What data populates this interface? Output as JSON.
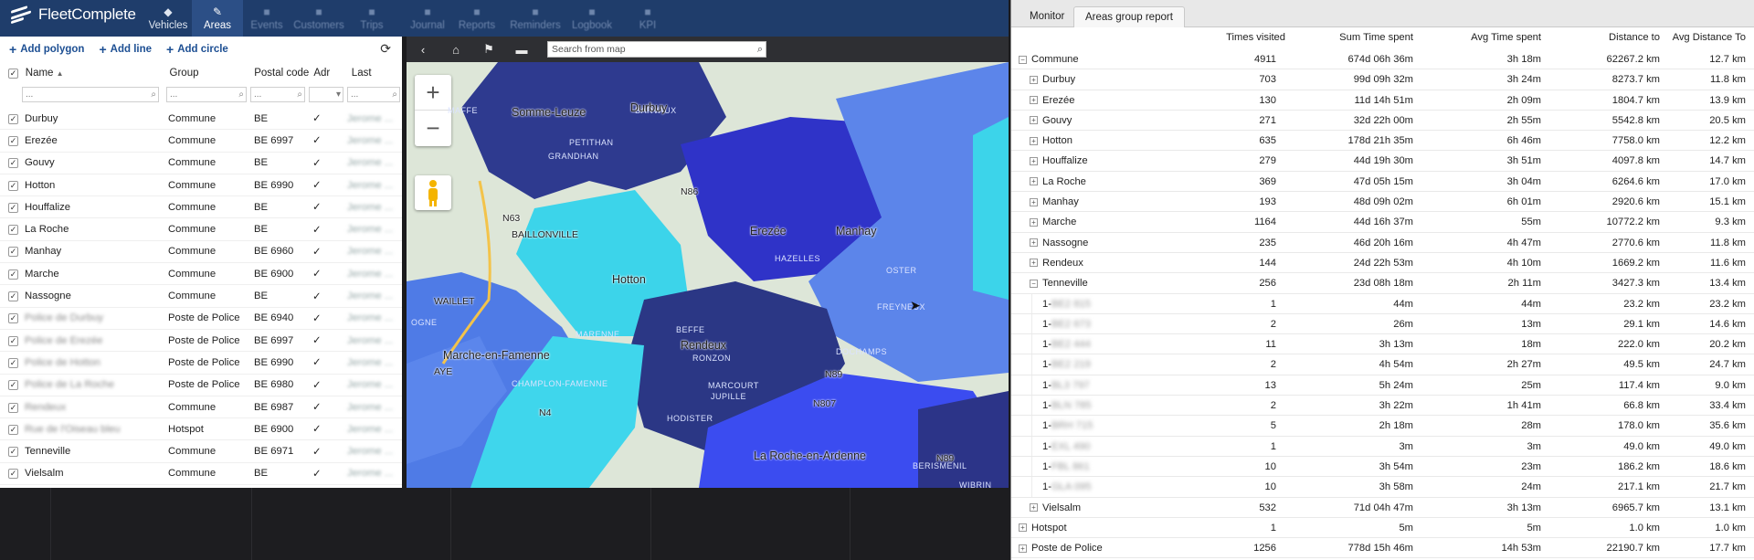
{
  "app": {
    "logo_text": "FleetComplete"
  },
  "nav": [
    {
      "label": "Vehicles",
      "icon": "car-icon"
    },
    {
      "label": "Areas",
      "icon": "pin-icon",
      "active": true
    },
    {
      "label": "Events",
      "icon": "alert-icon"
    },
    {
      "label": "Customers",
      "icon": "people-icon"
    },
    {
      "label": "Trips",
      "icon": "route-icon"
    },
    {
      "label": "Journal",
      "icon": "book-icon"
    },
    {
      "label": "Reports",
      "icon": "chart-icon"
    },
    {
      "label": "Reminders",
      "icon": "bell-icon"
    },
    {
      "label": "Logbook",
      "icon": "logbook-icon"
    },
    {
      "label": "KPI",
      "icon": "kpi-icon"
    }
  ],
  "toolbar": {
    "add_polygon": "Add polygon",
    "add_line": "Add line",
    "add_circle": "Add circle"
  },
  "columns": {
    "name": "Name",
    "group": "Group",
    "postal": "Postal code",
    "adr": "Adr",
    "last_update": "Last update"
  },
  "filter_placeholder": "...",
  "areas": [
    {
      "name": "Durbuy",
      "group": "Commune",
      "postal": "BE",
      "adr": "✓",
      "blur_name": false
    },
    {
      "name": "Erezée",
      "group": "Commune",
      "postal": "BE 6997",
      "adr": "✓",
      "blur_name": false
    },
    {
      "name": "Gouvy",
      "group": "Commune",
      "postal": "BE",
      "adr": "✓",
      "blur_name": false
    },
    {
      "name": "Hotton",
      "group": "Commune",
      "postal": "BE 6990",
      "adr": "✓",
      "blur_name": false
    },
    {
      "name": "Houffalize",
      "group": "Commune",
      "postal": "BE",
      "adr": "✓",
      "blur_name": false
    },
    {
      "name": "La Roche",
      "group": "Commune",
      "postal": "BE",
      "adr": "✓",
      "blur_name": false
    },
    {
      "name": "Manhay",
      "group": "Commune",
      "postal": "BE 6960",
      "adr": "✓",
      "blur_name": false
    },
    {
      "name": "Marche",
      "group": "Commune",
      "postal": "BE 6900",
      "adr": "✓",
      "blur_name": false
    },
    {
      "name": "Nassogne",
      "group": "Commune",
      "postal": "BE",
      "adr": "✓",
      "blur_name": false
    },
    {
      "name": "Police de Durbuy",
      "group": "Poste de Police",
      "postal": "BE 6940",
      "adr": "✓",
      "blur_name": true
    },
    {
      "name": "Police de Erezée",
      "group": "Poste de Police",
      "postal": "BE 6997",
      "adr": "✓",
      "blur_name": true
    },
    {
      "name": "Police de Hotton",
      "group": "Poste de Police",
      "postal": "BE 6990",
      "adr": "✓",
      "blur_name": true
    },
    {
      "name": "Police de La Roche",
      "group": "Poste de Police",
      "postal": "BE 6980",
      "adr": "✓",
      "blur_name": true
    },
    {
      "name": "Rendeux",
      "group": "Commune",
      "postal": "BE 6987",
      "adr": "✓",
      "blur_name": true
    },
    {
      "name": "Rue de l'Oiseau bleu",
      "group": "Hotspot",
      "postal": "BE 6900",
      "adr": "✓",
      "blur_name": true
    },
    {
      "name": "Tenneville",
      "group": "Commune",
      "postal": "BE 6971",
      "adr": "✓",
      "blur_name": false
    },
    {
      "name": "Vielsalm",
      "group": "Commune",
      "postal": "BE",
      "adr": "✓",
      "blur_name": false
    }
  ],
  "map": {
    "search_placeholder": "Search from map",
    "labels": [
      "Somme-Leuze",
      "BAILLONVILLE",
      "WAILLET",
      "Hotton",
      "Erezée",
      "HAZELLES",
      "Manhay",
      "Marche-en-Famenne",
      "CHAMPLON-FAMENNE",
      "Rendeux",
      "RONZON",
      "MARCOURT",
      "JUPILLE",
      "HODISTER",
      "DOCHAMPS",
      "FREYNEUX",
      "OSTER",
      "La Roche-en-Ardenne",
      "BERISMENIL",
      "WIBRIN",
      "NADRIN",
      "BEFFE",
      "MARENNE",
      "PETITHAN",
      "GRANDHAN",
      "BARVAUX",
      "Durbuy",
      "MAFFE",
      "AYE",
      "OGNE",
      "N63",
      "N86",
      "N89",
      "N4",
      "N807",
      "N89",
      "N30"
    ]
  },
  "report": {
    "tabs": [
      "Monitor",
      "Areas group report"
    ],
    "headers": [
      "Times visited",
      "Sum Time spent",
      "Avg Time spent",
      "Distance to",
      "Avg Distance To"
    ],
    "rows": [
      {
        "level": 0,
        "toggle": "−",
        "name": "Commune",
        "times": "4911",
        "sum": "674d 06h 36m",
        "avg": "3h 18m",
        "dist": "62267.2 km",
        "avgdist": "12.7 km"
      },
      {
        "level": 1,
        "toggle": "+",
        "name": "Durbuy",
        "times": "703",
        "sum": "99d 09h 32m",
        "avg": "3h 24m",
        "dist": "8273.7 km",
        "avgdist": "11.8 km"
      },
      {
        "level": 1,
        "toggle": "+",
        "name": "Erezée",
        "times": "130",
        "sum": "11d 14h 51m",
        "avg": "2h 09m",
        "dist": "1804.7 km",
        "avgdist": "13.9 km"
      },
      {
        "level": 1,
        "toggle": "+",
        "name": "Gouvy",
        "times": "271",
        "sum": "32d 22h 00m",
        "avg": "2h 55m",
        "dist": "5542.8 km",
        "avgdist": "20.5 km"
      },
      {
        "level": 1,
        "toggle": "+",
        "name": "Hotton",
        "times": "635",
        "sum": "178d 21h 35m",
        "avg": "6h 46m",
        "dist": "7758.0 km",
        "avgdist": "12.2 km"
      },
      {
        "level": 1,
        "toggle": "+",
        "name": "Houffalize",
        "times": "279",
        "sum": "44d 19h 30m",
        "avg": "3h 51m",
        "dist": "4097.8 km",
        "avgdist": "14.7 km"
      },
      {
        "level": 1,
        "toggle": "+",
        "name": "La Roche",
        "times": "369",
        "sum": "47d 05h 15m",
        "avg": "3h 04m",
        "dist": "6264.6 km",
        "avgdist": "17.0 km"
      },
      {
        "level": 1,
        "toggle": "+",
        "name": "Manhay",
        "times": "193",
        "sum": "48d 09h 02m",
        "avg": "6h 01m",
        "dist": "2920.6 km",
        "avgdist": "15.1 km"
      },
      {
        "level": 1,
        "toggle": "+",
        "name": "Marche",
        "times": "1164",
        "sum": "44d 16h 37m",
        "avg": "55m",
        "dist": "10772.2 km",
        "avgdist": "9.3 km"
      },
      {
        "level": 1,
        "toggle": "+",
        "name": "Nassogne",
        "times": "235",
        "sum": "46d 20h 16m",
        "avg": "4h 47m",
        "dist": "2770.6 km",
        "avgdist": "11.8 km"
      },
      {
        "level": 1,
        "toggle": "+",
        "name": "Rendeux",
        "times": "144",
        "sum": "24d 22h 53m",
        "avg": "4h 10m",
        "dist": "1669.2 km",
        "avgdist": "11.6 km"
      },
      {
        "level": 1,
        "toggle": "−",
        "name": "Tenneville",
        "times": "256",
        "sum": "23d 08h 18m",
        "avg": "2h 11m",
        "dist": "3427.3 km",
        "avgdist": "13.4 km"
      },
      {
        "level": 2,
        "toggle": "",
        "name": "1-",
        "hidden": "BE2 815",
        "times": "1",
        "sum": "44m",
        "avg": "44m",
        "dist": "23.2 km",
        "avgdist": "23.2 km"
      },
      {
        "level": 2,
        "toggle": "",
        "name": "1-",
        "hidden": "BE2 673",
        "times": "2",
        "sum": "26m",
        "avg": "13m",
        "dist": "29.1 km",
        "avgdist": "14.6 km"
      },
      {
        "level": 2,
        "toggle": "",
        "name": "1-",
        "hidden": "BE2 444",
        "times": "11",
        "sum": "3h 13m",
        "avg": "18m",
        "dist": "222.0 km",
        "avgdist": "20.2 km"
      },
      {
        "level": 2,
        "toggle": "",
        "name": "1-",
        "hidden": "BE2 219",
        "times": "2",
        "sum": "4h 54m",
        "avg": "2h 27m",
        "dist": "49.5 km",
        "avgdist": "24.7 km"
      },
      {
        "level": 2,
        "toggle": "",
        "name": "1-",
        "hidden": "BL3 797",
        "times": "13",
        "sum": "5h 24m",
        "avg": "25m",
        "dist": "117.4 km",
        "avgdist": "9.0 km"
      },
      {
        "level": 2,
        "toggle": "",
        "name": "1-",
        "hidden": "BLN 785",
        "times": "2",
        "sum": "3h 22m",
        "avg": "1h 41m",
        "dist": "66.8 km",
        "avgdist": "33.4 km"
      },
      {
        "level": 2,
        "toggle": "",
        "name": "1-",
        "hidden": "BRH 715",
        "times": "5",
        "sum": "2h 18m",
        "avg": "28m",
        "dist": "178.0 km",
        "avgdist": "35.6 km"
      },
      {
        "level": 2,
        "toggle": "",
        "name": "1-",
        "hidden": "EXL 490",
        "times": "1",
        "sum": "3m",
        "avg": "3m",
        "dist": "49.0 km",
        "avgdist": "49.0 km"
      },
      {
        "level": 2,
        "toggle": "",
        "name": "1-",
        "hidden": "FBL 861",
        "times": "10",
        "sum": "3h 54m",
        "avg": "23m",
        "dist": "186.2 km",
        "avgdist": "18.6 km"
      },
      {
        "level": 2,
        "toggle": "",
        "name": "1-",
        "hidden": "GLA 095",
        "times": "10",
        "sum": "3h 58m",
        "avg": "24m",
        "dist": "217.1 km",
        "avgdist": "21.7 km"
      },
      {
        "level": 1,
        "toggle": "+",
        "name": "Vielsalm",
        "times": "532",
        "sum": "71d 04h 47m",
        "avg": "3h 13m",
        "dist": "6965.7 km",
        "avgdist": "13.1 km"
      },
      {
        "level": 0,
        "toggle": "+",
        "name": "Hotspot",
        "times": "1",
        "sum": "5m",
        "avg": "5m",
        "dist": "1.0 km",
        "avgdist": "1.0 km"
      },
      {
        "level": 0,
        "toggle": "+",
        "name": "Poste de Police",
        "times": "1256",
        "sum": "778d 15h 46m",
        "avg": "14h 53m",
        "dist": "22190.7 km",
        "avgdist": "17.7 km"
      }
    ]
  }
}
